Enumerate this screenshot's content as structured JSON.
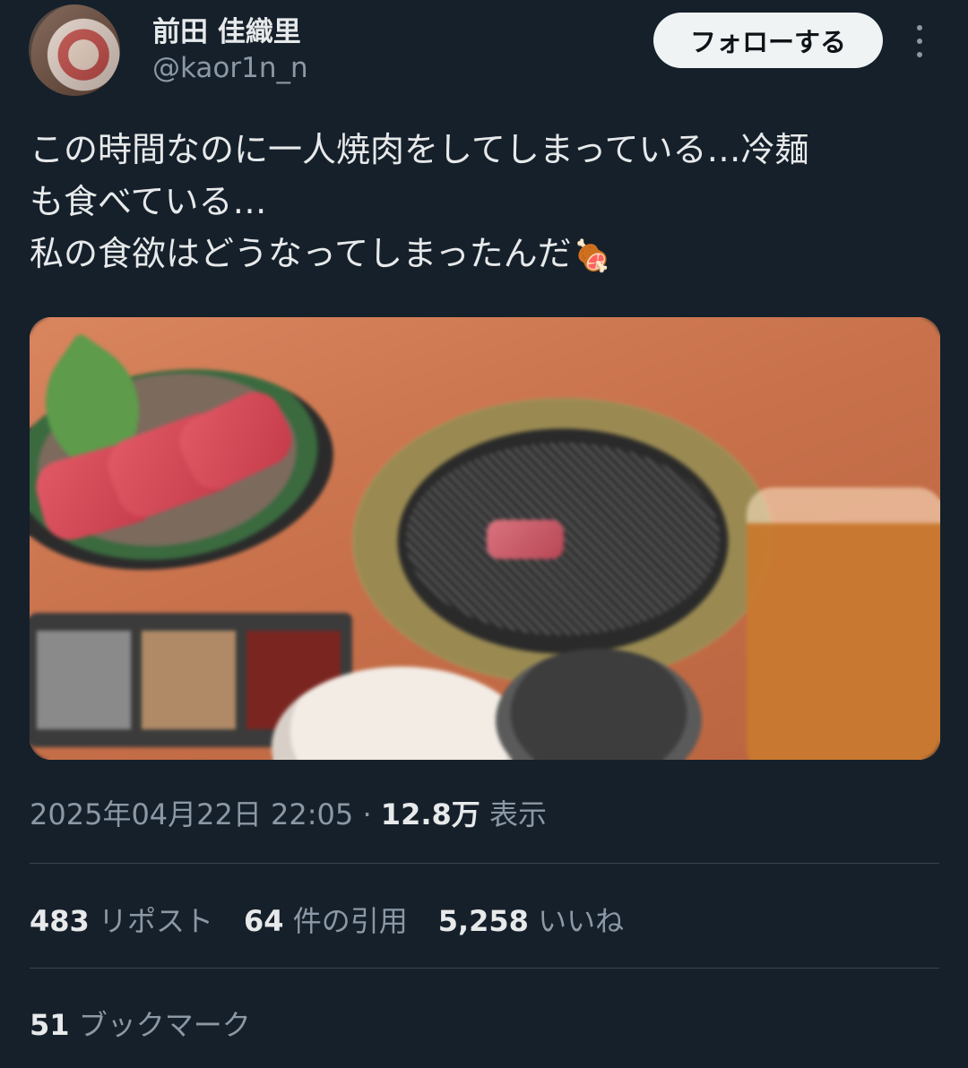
{
  "user": {
    "display_name": "前田 佳織里",
    "handle": "@kaor1n_n",
    "follow_label": "フォローする"
  },
  "tweet": {
    "lines": [
      "この時間なのに一人焼肉をしてしまっている…冷麺",
      "も食べている…",
      "私の食欲はどうなってしまったんだ"
    ],
    "emoji": "🍖"
  },
  "meta": {
    "datetime": "2025年04月22日 22:05",
    "separator": " · ",
    "views": "12.8万",
    "views_label": "表示"
  },
  "stats": {
    "reposts": "483",
    "reposts_label": "リポスト",
    "quotes": "64",
    "quotes_label": "件の引用",
    "likes": "5,258",
    "likes_label": "いいね"
  },
  "bookmarks": {
    "count": "51",
    "label": "ブックマーク"
  },
  "colors": {
    "background": "#15202b",
    "text": "#e7e9ea",
    "secondary": "#8b98a5",
    "divider": "#38444d",
    "follow_button": "#eff3f4"
  }
}
